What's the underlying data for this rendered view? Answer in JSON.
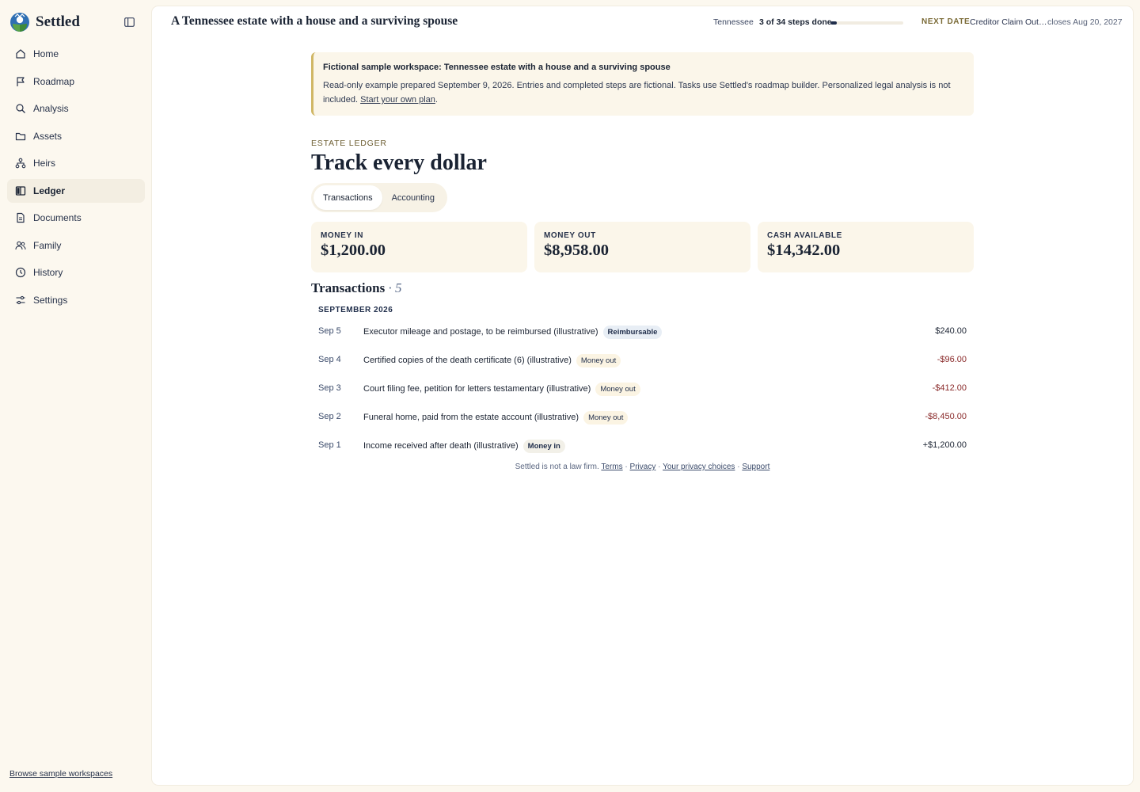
{
  "app": {
    "name": "Settled"
  },
  "sidebar": {
    "items": [
      {
        "label": "Home",
        "icon": "home-icon"
      },
      {
        "label": "Roadmap",
        "icon": "flag-icon"
      },
      {
        "label": "Analysis",
        "icon": "magnifier-icon"
      },
      {
        "label": "Assets",
        "icon": "folder-icon"
      },
      {
        "label": "Heirs",
        "icon": "tree-icon"
      },
      {
        "label": "Ledger",
        "icon": "book-icon",
        "active": true
      },
      {
        "label": "Documents",
        "icon": "document-icon"
      },
      {
        "label": "Family",
        "icon": "people-icon"
      },
      {
        "label": "History",
        "icon": "clock-icon"
      },
      {
        "label": "Settings",
        "icon": "sliders-icon"
      }
    ],
    "browse_link": "Browse sample workspaces"
  },
  "header": {
    "title": "A Tennessee estate with a house and a surviving spouse",
    "state": "Tennessee",
    "steps": "3 of 34 steps done",
    "progress": 0.088,
    "next_label": "NEXT DATE",
    "next_event": "Creditor Claim Out…",
    "next_close": "closes Aug 20, 2027"
  },
  "notice": {
    "title": "Fictional sample workspace: Tennessee estate with a house and a surviving spouse",
    "body": "Read-only example prepared September 9, 2026. Entries and completed steps are fictional. Tasks use Settled's roadmap builder. Personalized legal analysis is not included.",
    "link": "Start your own plan",
    "link_suffix": "."
  },
  "page": {
    "eyebrow": "ESTATE LEDGER",
    "title": "Track every dollar",
    "tabs": [
      "Transactions",
      "Accounting"
    ]
  },
  "stats": [
    {
      "label": "MONEY IN",
      "value": "$1,200.00"
    },
    {
      "label": "MONEY OUT",
      "value": "$8,958.00"
    },
    {
      "label": "CASH AVAILABLE",
      "value": "$14,342.00"
    }
  ],
  "transactions": {
    "heading": "Transactions",
    "count": "· 5",
    "month": "SEPTEMBER 2026",
    "rows": [
      {
        "date": "Sep 5",
        "desc": "Executor mileage and postage, to be reimbursed (illustrative)",
        "badge": "Reimbursable",
        "amount": "$240.00"
      },
      {
        "date": "Sep 4",
        "desc": "Certified copies of the death certificate (6) (illustrative)",
        "badge": "Money out",
        "amount": "-$96.00"
      },
      {
        "date": "Sep 3",
        "desc": "Court filing fee, petition for letters testamentary (illustrative)",
        "badge": "Money out",
        "amount": "-$412.00"
      },
      {
        "date": "Sep 2",
        "desc": "Funeral home, paid from the estate account (illustrative)",
        "badge": "Money out",
        "amount": "-$8,450.00"
      },
      {
        "date": "Sep 1",
        "desc": "Income received after death (illustrative)",
        "badge": "Money in",
        "amount": "+$1,200.00"
      }
    ]
  },
  "footer": {
    "text": "Settled is not a law firm.",
    "links": [
      "Terms",
      "Privacy",
      "Your privacy choices",
      "Support"
    ],
    "separator": "·"
  },
  "colors": {
    "accent": "#1f2d4a",
    "negative": "#8a2a2a",
    "notice_border": "#d0b766",
    "background": "#fcf8ef"
  }
}
